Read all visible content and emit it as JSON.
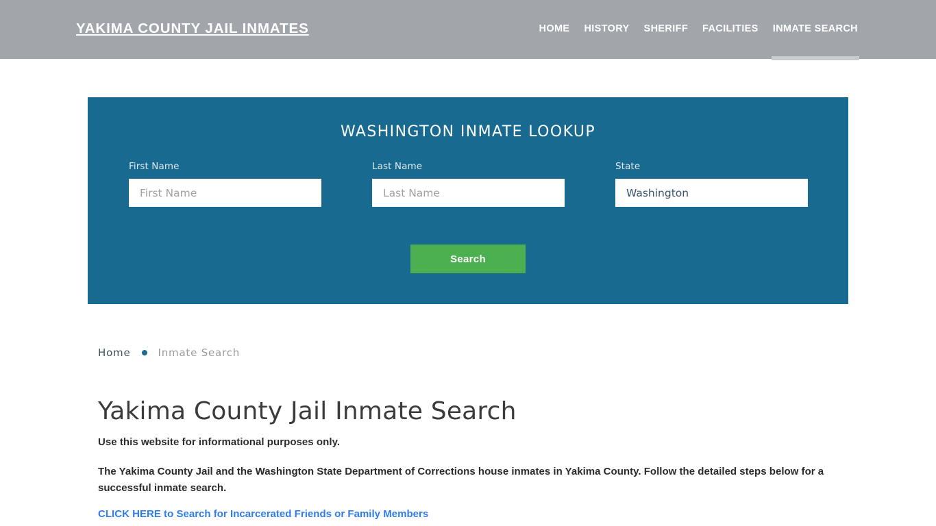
{
  "header": {
    "brand": "Yakima County Jail Inmates",
    "background_color": "#a1a6aa",
    "nav": [
      {
        "label": "Home",
        "active": false
      },
      {
        "label": "History",
        "active": false
      },
      {
        "label": "Sheriff",
        "active": false
      },
      {
        "label": "Facilities",
        "active": false
      },
      {
        "label": "Inmate Search",
        "active": true
      }
    ]
  },
  "lookup": {
    "title": "Washington Inmate Lookup",
    "panel_color": "#186a91",
    "fields": {
      "first_name": {
        "label": "First Name",
        "placeholder": "First Name",
        "value": ""
      },
      "last_name": {
        "label": "Last Name",
        "placeholder": "Last Name",
        "value": ""
      },
      "state": {
        "label": "State",
        "placeholder": "State",
        "value": "Washington"
      }
    },
    "submit_label": "Search",
    "submit_color": "#4cb050"
  },
  "breadcrumb": {
    "home_label": "Home",
    "separator": "•",
    "current_label": "Inmate Search"
  },
  "article": {
    "title": "Yakima County Jail Inmate Search",
    "lead": "Use this website for informational purposes only.",
    "paragraph": "The Yakima County Jail and the Washington State Department of Corrections house inmates in Yakima County. Follow the detailed steps below for a successful inmate search.",
    "cta_link": "CLICK HERE to Search for Incarcerated Friends or Family Members",
    "cta_color": "#2f7ced"
  }
}
